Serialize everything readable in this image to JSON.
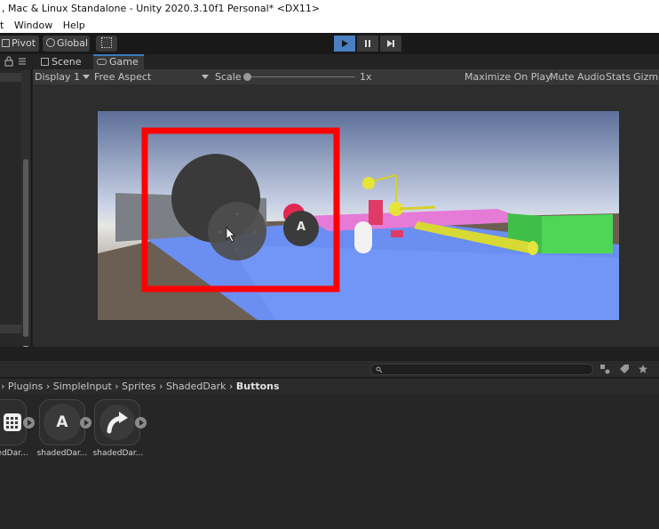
{
  "window": {
    "title": ", Mac & Linux Standalone - Unity 2020.3.10f1 Personal* <DX11>",
    "menu": [
      "t",
      "Window",
      "Help"
    ]
  },
  "toolbar": {
    "pivot_label": "Pivot",
    "global_label": "Global"
  },
  "tabs": {
    "scene_label": "Scene",
    "game_label": "Game"
  },
  "gamebar": {
    "display": "Display 1",
    "aspect": "Free Aspect",
    "scale_label": "Scale",
    "scale_value": "1x",
    "maximize": "Maximize On Play",
    "mute": "Mute Audio",
    "stats": "Stats",
    "gizmos": "Gizmo"
  },
  "scene": {
    "button_label": "A"
  },
  "breadcrumb": {
    "items": [
      "Plugins",
      "SimpleInput",
      "Sprites",
      "ShadedDark"
    ],
    "current": "Buttons"
  },
  "assets": [
    {
      "label": "edDar...",
      "icon": "grid-icon"
    },
    {
      "label": "shadedDar...",
      "icon": "letter-a-icon",
      "glyph": "A"
    },
    {
      "label": "shadedDar...",
      "icon": "curved-arrow-icon"
    }
  ],
  "colors": {
    "highlight": "#ff0000",
    "play_active": "#4a7fc2"
  }
}
